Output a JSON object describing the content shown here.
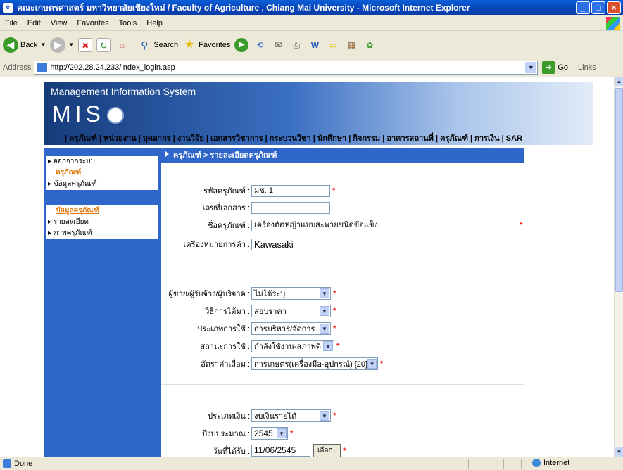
{
  "window": {
    "title": "คณะเกษตรศาสตร์ มหาวิทยาลัยเชียงใหม่ / Faculty of Agriculture , Chiang Mai University   - Microsoft Internet Explorer"
  },
  "menu": [
    "File",
    "Edit",
    "View",
    "Favorites",
    "Tools",
    "Help"
  ],
  "toolbar": {
    "back": "Back",
    "search": "Search",
    "favorites": "Favorites"
  },
  "address": {
    "label": "Address",
    "url": "http://202.28.24.233/index_login.asp",
    "go": "Go",
    "links": "Links"
  },
  "banner": {
    "title": "Management Information System",
    "logo_text": "MIS"
  },
  "nav": "| ครุภัณฑ์ | หน่วยงาน | บุคลากร | งานวิจัย | เอกสารวิชาการ | กระบวนวิชา | นักศึกษา | กิจกรรม | อาคารสถานที่ | ครุภัณฑ์ | การเงิน | SAR",
  "sidebar": {
    "logout": "ออกจากระบบ",
    "section1_head": "ครุภัณฑ์",
    "section1_item": "ข้อมูลครุภัณฑ์",
    "section2_head": "ข้อมูลครุภัณฑ์",
    "section2_items": [
      "รายละเอียด",
      "ภาพครุภัณฑ์"
    ]
  },
  "breadcrumb": "ครุภัณฑ์ > รายละเอียดครุภัณฑ์",
  "form": {
    "asset_code_label": "รหัสครุภัณฑ์ :",
    "asset_code_value": "มช. 1",
    "doc_no_label": "เลขที่เอกสาร :",
    "doc_no_value": "",
    "asset_name_label": "ชื่อครุภัณฑ์ :",
    "asset_name_value": "เครื่องตัดหญ้าแบบสะพายชนิดข้อแข็ง",
    "brand_label": "เครื่องหมายการค้า :",
    "brand_value": "Kawasaki",
    "seller_label": "ผู้ขาย/ผู้รับจ้าง/ผู้บริจาค :",
    "seller_value": "ไม่ได้ระบุ",
    "method_label": "วิธีการได้มา :",
    "method_value": "สอบราคา",
    "usage_type_label": "ประเภทการใช้ :",
    "usage_type_value": "การบริหาร/จัดการ",
    "status_label": "สถานะการใช้ :",
    "status_value": "กำลังใช้งาน-สภาพดี",
    "depreciation_label": "อัตราค่าเสื่อม :",
    "depreciation_value": "การเกษตร(เครื่องมือ-อุปกรณ์) [20]",
    "fund_type_label": "ประเภทเงิน :",
    "fund_type_value": "งบเงินรายได้",
    "fiscal_year_label": "ปีงบประมาณ :",
    "fiscal_year_value": "2545",
    "receive_date_label": "วันที่ได้รับ :",
    "receive_date_value": "11/06/2545",
    "pick_button": "เลือก..",
    "required_mark": "*"
  },
  "status": {
    "left": "Done",
    "zone": "Internet"
  },
  "colors": {
    "sidebar": "#2f66c9",
    "section_head": "#e07a10",
    "required": "#e11111"
  }
}
